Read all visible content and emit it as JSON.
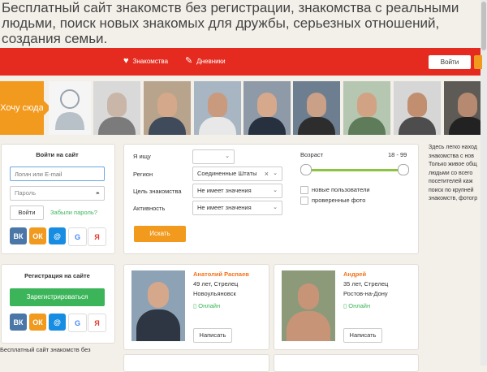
{
  "header": {
    "title": "Бесплатный сайт знакомств без регистрации, знакомства с реальными людьми, поиск новых знакомых для дружбы, серьезных отношений, создания семьи."
  },
  "nav": {
    "items": [
      {
        "label": "Знакомства",
        "icon": "heart-icon"
      },
      {
        "label": "Дневники",
        "icon": "pencil-icon"
      }
    ],
    "login_button": "Войти"
  },
  "strip": {
    "want_label": "Хочу сюда"
  },
  "login_card": {
    "title": "Войти на сайт",
    "login_placeholder": "Логин или E-mail",
    "password_placeholder": "Пароль",
    "submit_label": "Войти",
    "forgot_link": "Забыли пароль?",
    "socials": [
      "ВК",
      "ОК",
      "@",
      "G",
      "Я"
    ]
  },
  "register_card": {
    "title": "Регистрация на сайте",
    "button_label": "Зарегистрироваться",
    "socials": [
      "ВК",
      "ОК",
      "@",
      "G",
      "Я"
    ]
  },
  "search": {
    "looking_for_label": "Я ищу",
    "looking_for_value": "",
    "region_label": "Регион",
    "region_value": "Соединенные Штаты",
    "goal_label": "Цель знакомства",
    "goal_value": "Не имеет значения",
    "activity_label": "Активность",
    "activity_value": "Не имеет значения",
    "search_button": "Искать",
    "age_label": "Возраст",
    "age_range": "18 - 99",
    "new_users_label": "новые пользователи",
    "verified_photo_label": "проверенные фото"
  },
  "users": [
    {
      "name": "Анатолий Распаев",
      "age_sign": "49 лет, Стрелец",
      "city": "Новоульяновск",
      "status": "Онлайн",
      "write_label": "Написать"
    },
    {
      "name": "Андрей",
      "age_sign": "35 лет, Стрелец",
      "city": "Ростов-на-Дону",
      "status": "Онлайн",
      "write_label": "Написать"
    }
  ],
  "right_text": [
    "Здесь легко наход",
    "знакомства с нов",
    "Только живое общ",
    "людьми со всего",
    "посетителей каж",
    "поиск по крупней",
    "знакомств, фотогр"
  ],
  "footer_text": "Бесплатный сайт знакомств без",
  "colors": {
    "nav_red": "#e52b20",
    "accent_orange": "#f29a1d",
    "register_green": "#3cb55a",
    "vk_blue": "#4a76a8",
    "ok_orange": "#f29a1d",
    "mail_blue": "#168de2",
    "yandex_red": "#e03a2f"
  }
}
